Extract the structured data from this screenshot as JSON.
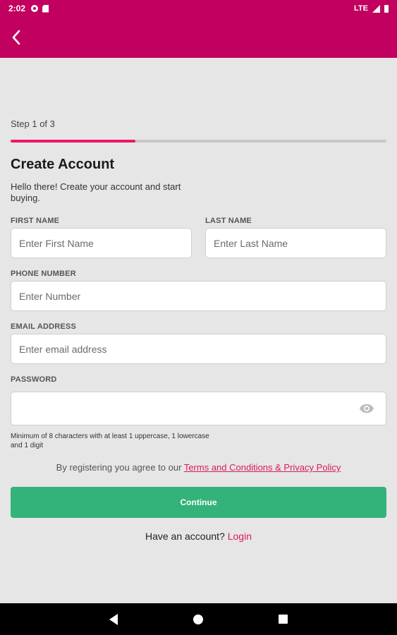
{
  "status_bar": {
    "time": "2:02",
    "network": "LTE"
  },
  "colors": {
    "brand": "#c2005f",
    "accent": "#e8186d",
    "primary_button": "#33b27a",
    "link": "#d81b60",
    "background": "#e6e6e6"
  },
  "form": {
    "step_text": "Step 1 of 3",
    "step_progress": 0.333,
    "title": "Create Account",
    "subtitle": "Hello there! Create your account and start buying.",
    "first_name": {
      "label": "FIRST NAME",
      "placeholder": "Enter First Name",
      "value": ""
    },
    "last_name": {
      "label": "LAST NAME",
      "placeholder": "Enter Last Name",
      "value": ""
    },
    "phone": {
      "label": "PHONE NUMBER",
      "placeholder": "Enter Number",
      "value": ""
    },
    "email": {
      "label": "EMAIL ADDRESS",
      "placeholder": "Enter email address",
      "value": ""
    },
    "password": {
      "label": "PASSWORD",
      "placeholder": "",
      "value": "",
      "hint": "Minimum of 8 characters with at least 1 uppercase, 1 lowercase and 1 digit"
    },
    "terms_prefix": "By registering you agree to our ",
    "terms_link": "Terms and Conditions & Privacy Policy",
    "continue_label": "Continue",
    "login_prefix": "Have an account? ",
    "login_link": "Login"
  },
  "icons": [
    "settings-icon",
    "sd-card-icon",
    "signal-icon",
    "battery-icon",
    "back-arrow-icon",
    "eye-icon",
    "nav-back-icon",
    "nav-home-icon",
    "nav-recents-icon"
  ]
}
